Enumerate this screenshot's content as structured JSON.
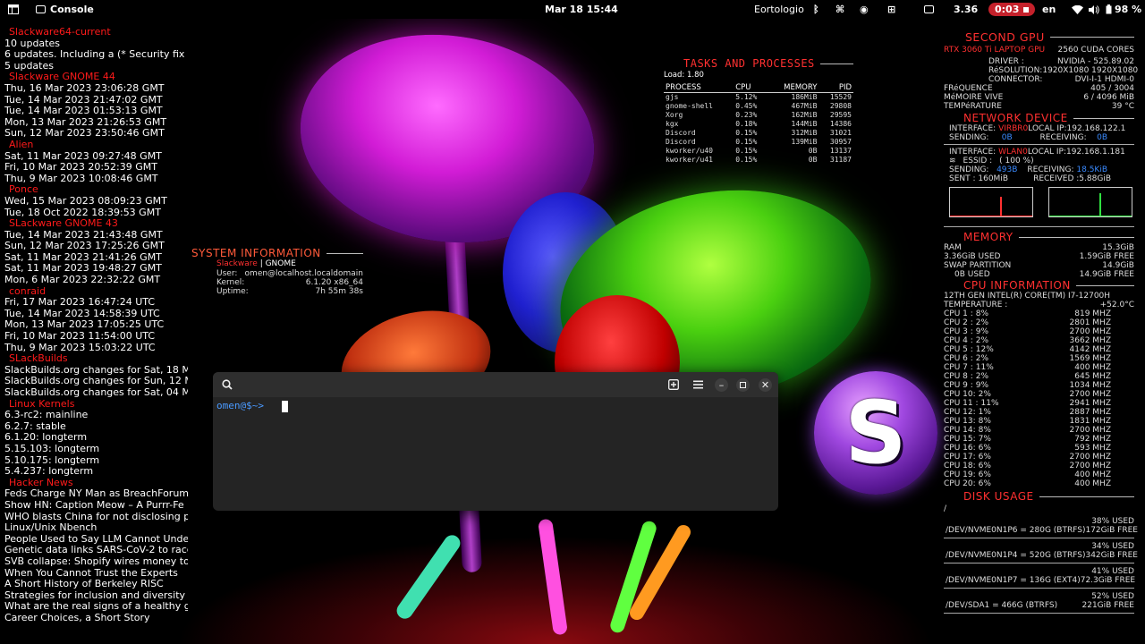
{
  "topbar": {
    "app_name": "Console",
    "clock": "Mar 18  15:44",
    "app_indicator": "Eortologio",
    "net_speed": "3.36",
    "recording_time": "0:03",
    "language": "en",
    "battery": "98 %",
    "icons": [
      "activities-icon",
      "console-icon",
      "bluetooth-icon",
      "font-icon",
      "discord-icon",
      "grid-icon",
      "terminal-icon",
      "record-stop-icon",
      "wifi-icon",
      "volume-icon",
      "battery-icon"
    ]
  },
  "feeds": [
    {
      "title": "Slackware64-current",
      "items": [
        "10 updates",
        "6 updates. Including a (* Security fix *)!",
        "5 updates"
      ]
    },
    {
      "title": "Slackware GNOME 44",
      "items": [
        "Thu, 16 Mar 2023 23:06:28 GMT",
        "Tue, 14 Mar 2023 21:47:02 GMT",
        "Tue, 14 Mar 2023 01:53:13 GMT",
        "Mon, 13 Mar 2023 21:26:53 GMT",
        "Sun, 12 Mar 2023 23:50:46 GMT"
      ]
    },
    {
      "title": "Alien",
      "items": [
        "Sat, 11 Mar 2023 09:27:48 GMT",
        "Fri, 10 Mar 2023 20:52:39 GMT",
        "Thu,  9 Mar 2023 10:08:46 GMT"
      ]
    },
    {
      "title": "Ponce",
      "items": [
        "Wed, 15 Mar 2023 08:09:23 GMT",
        "Tue, 18 Oct 2022 18:39:53 GMT"
      ]
    },
    {
      "title": "SLackware GNOME 43",
      "items": [
        "Tue, 14 Mar 2023 21:43:48 GMT",
        "Sun, 12 Mar 2023 17:25:26 GMT",
        "Sat, 11 Mar 2023 21:41:26 GMT",
        "Sat, 11 Mar 2023 19:48:27 GMT",
        "Mon,  6 Mar 2023 22:32:22 GMT"
      ]
    },
    {
      "title": "conraid",
      "items": [
        "Fri, 17 Mar 2023 16:47:24 UTC",
        "Tue, 14 Mar 2023 14:58:39 UTC",
        "Mon, 13 Mar 2023 17:05:25 UTC",
        "Fri, 10 Mar 2023 11:54:00 UTC",
        "Thu,  9 Mar 2023 15:03:22 UTC"
      ]
    },
    {
      "title": "SLackBuilds",
      "items": [
        "SlackBuilds.org changes for Sat, 18 Mar",
        "SlackBuilds.org changes for Sun, 12 Ma",
        "SlackBuilds.org changes for Sat, 04 Mar"
      ]
    },
    {
      "title": "Linux Kernels",
      "items": [
        "6.3-rc2: mainline",
        "6.2.7: stable",
        "6.1.20: longterm",
        "5.15.103: longterm",
        "5.10.175: longterm",
        "5.4.237: longterm"
      ]
    },
    {
      "title": "Hacker News",
      "items": [
        "Feds Charge NY Man as BreachForum",
        "Show HN: Caption Meow – A Purrr-Fe",
        "WHO blasts China for not disclosing po",
        "Linux/Unix Nbench",
        "People Used to Say LLM Cannot Under",
        "Genetic data links SARS-CoV-2 to racc",
        "SVB collapse: Shopify wires money to",
        "When You Cannot Trust the Experts",
        "A Short History of Berkeley RISC",
        "Strategies for inclusion and diversity in T",
        "What are the real signs of a healthy gut",
        "Career Choices, a Short Story"
      ]
    }
  ],
  "tasks": {
    "title": "TASKS AND PROCESSES",
    "load": "Load: 1.80",
    "headers": [
      "PROCESS",
      "CPU",
      "MEMORY",
      "PID"
    ],
    "rows": [
      [
        "gjs",
        "5.12%",
        "186MiB",
        "15529"
      ],
      [
        "gnome-shell",
        "0.45%",
        "467MiB",
        "29808"
      ],
      [
        "Xorg",
        "0.23%",
        "162MiB",
        "29595"
      ],
      [
        "kgx",
        "0.18%",
        "144MiB",
        "14386"
      ],
      [
        "Discord",
        "0.15%",
        "312MiB",
        "31021"
      ],
      [
        "Discord",
        "0.15%",
        "139MiB",
        "30957"
      ],
      [
        "kworker/u40",
        "0.15%",
        "0B",
        "13137"
      ],
      [
        "kworker/u41",
        "0.15%",
        "0B",
        "31187"
      ]
    ]
  },
  "sysinfo": {
    "title": "SYSTEM INFORMATION",
    "distro": "Slackware",
    "desktop": "| GNOME",
    "user_label": "User:",
    "user_value": "omen@localhost.localdomain",
    "kernel_label": "Kernel:",
    "kernel_value": "6.1.20 x86_64",
    "uptime_label": "Uptime:",
    "uptime_value": "7h 55m 38s"
  },
  "gpu": {
    "title": "SECOND GPU",
    "model": "RTX 3060 Ti LAPTOP GPU",
    "cores": "2560 CUDA CORES",
    "driver_label": "DRIVER :",
    "driver_value": "NVIDIA - 525.89.02",
    "resolution_label": "RéSOLUTION:",
    "resolution_value": "1920X1080   1920X1080",
    "connector_label": "CONNECTOR:",
    "connector_value": "DVI-I-1    HDMI-0",
    "freq_label": "FRéQUENCE",
    "freq_value": "405 / 3004",
    "mem_label": "MéMOIRE VIVE",
    "mem_value": "6 / 4096 MiB",
    "temp_label": "TEMPéRATURE",
    "temp_value": "39 °C"
  },
  "network": {
    "title": "NETWORK DEVICE",
    "if1_label": "INTERFACE:",
    "if1_value": "VIRBR0",
    "if1_ip": "LOCAL IP:192.168.122.1",
    "if1_send_label": "SENDING:",
    "if1_send": "0B",
    "if1_recv_label": "RECEIVING:",
    "if1_recv": "0B",
    "if2_label": "INTERFACE:",
    "if2_value": "WLAN0",
    "if2_ip": "LOCAL IP:192.168.1.181",
    "essid_label": "ESSID :",
    "essid_value": "( 100 %)",
    "if2_send_label": "SENDING:",
    "if2_send": "493B",
    "if2_recv_label": "RECEIVING:",
    "if2_recv": "18.5KiB",
    "sent": "SENT : 160MiB",
    "received": "RECEIVED :5.88GiB"
  },
  "memory": {
    "title": "MEMORY",
    "ram_label": "RAM",
    "ram_total": "15.3GiB",
    "ram_used": "3.36GiB USED",
    "ram_free": "1.59GiB FREE",
    "swap_label": "SWAP PARTITION",
    "swap_total": "14.9GiB",
    "swap_used": "0B USED",
    "swap_free": "14.9GiB FREE"
  },
  "cpu": {
    "title": "CPU INFORMATION",
    "model": "12TH GEN INTEL(R) CORE(TM) I7-12700H",
    "temp_label": "TEMPERATURE :",
    "temp_value": "+52.0°C",
    "cores": [
      {
        "label": "CPU  1 :",
        "usage": "8%",
        "freq": "819 MHZ"
      },
      {
        "label": "CPU  2 :",
        "usage": "2%",
        "freq": "2801 MHZ"
      },
      {
        "label": "CPU  3 :",
        "usage": "9%",
        "freq": "2700 MHZ"
      },
      {
        "label": "CPU  4 :",
        "usage": "2%",
        "freq": "3662 MHZ"
      },
      {
        "label": "CPU  5 :",
        "usage": "12%",
        "freq": "4142 MHZ"
      },
      {
        "label": "CPU  6 :",
        "usage": "2%",
        "freq": "1569 MHZ"
      },
      {
        "label": "CPU  7 :",
        "usage": "11%",
        "freq": "400 MHZ"
      },
      {
        "label": "CPU  8 :",
        "usage": "2%",
        "freq": "645 MHZ"
      },
      {
        "label": "CPU  9 :",
        "usage": "9%",
        "freq": "1034 MHZ"
      },
      {
        "label": "CPU  10:",
        "usage": "2%",
        "freq": "2700 MHZ"
      },
      {
        "label": "CPU  11 :",
        "usage": "11%",
        "freq": "2941 MHZ"
      },
      {
        "label": "CPU  12:",
        "usage": "1%",
        "freq": "2887 MHZ"
      },
      {
        "label": "CPU  13:",
        "usage": "8%",
        "freq": "1831 MHZ"
      },
      {
        "label": "CPU  14:",
        "usage": "8%",
        "freq": "2700 MHZ"
      },
      {
        "label": "CPU  15:",
        "usage": "7%",
        "freq": "792 MHZ"
      },
      {
        "label": "CPU  16:",
        "usage": "6%",
        "freq": "593 MHZ"
      },
      {
        "label": "CPU  17:",
        "usage": "6%",
        "freq": "2700 MHZ"
      },
      {
        "label": "CPU  18:",
        "usage": "6%",
        "freq": "2700 MHZ"
      },
      {
        "label": "CPU  19:",
        "usage": "6%",
        "freq": "400 MHZ"
      },
      {
        "label": "CPU  20:",
        "usage": "6%",
        "freq": "400 MHZ"
      }
    ]
  },
  "disk": {
    "title": "DISK USAGE",
    "root": "/",
    "parts": [
      {
        "name": "/DEV/NVME0N1P6 = 280G (BTRFS)",
        "used": "38% USED",
        "free": "172GiB FREE"
      },
      {
        "name": "/DEV/NVME0N1P4 = 520G (BTRFS)",
        "used": "34% USED",
        "free": "342GiB FREE"
      },
      {
        "name": "/DEV/NVME0N1P7 = 136G (EXT4)",
        "used": "41% USED",
        "free": "72.3GiB FREE"
      },
      {
        "name": "/DEV/SDA1 = 466G (BTRFS)",
        "used": "52% USED",
        "free": "221GiB FREE"
      }
    ]
  },
  "terminal": {
    "prompt": "omen@$~>"
  },
  "logo_letter": "S",
  "colors": {
    "accent_red": "#ff3030",
    "feed_header": "#ff1a1a",
    "net_blue": "#3a8aff",
    "recording": "#c4212b",
    "prompt_blue": "#4a9aff"
  }
}
